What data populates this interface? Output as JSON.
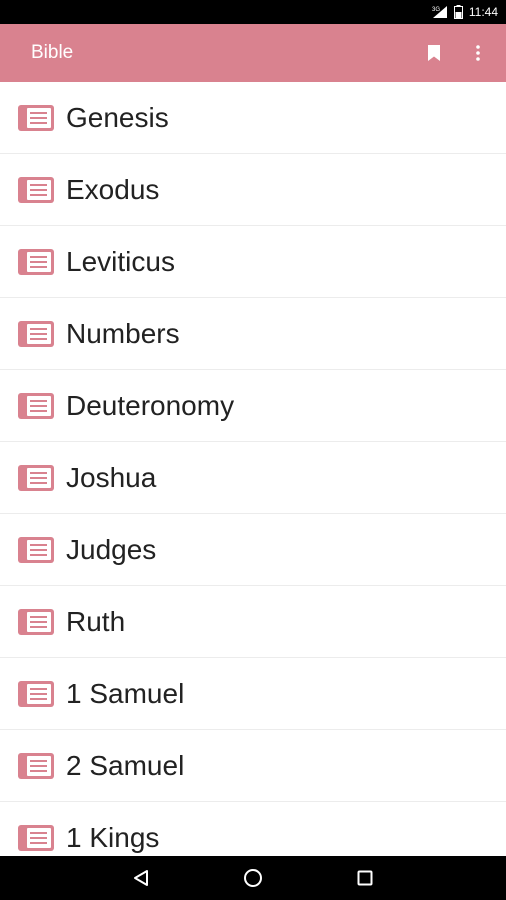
{
  "status_bar": {
    "time": "11:44",
    "icons": [
      "signal-icon",
      "battery-icon"
    ]
  },
  "app_bar": {
    "title": "Bible",
    "actions": [
      "bookmark-icon",
      "more-vert-icon"
    ]
  },
  "books": [
    {
      "label": "Genesis"
    },
    {
      "label": "Exodus"
    },
    {
      "label": "Leviticus"
    },
    {
      "label": "Numbers"
    },
    {
      "label": "Deuteronomy"
    },
    {
      "label": "Joshua"
    },
    {
      "label": "Judges"
    },
    {
      "label": "Ruth"
    },
    {
      "label": "1 Samuel"
    },
    {
      "label": "2 Samuel"
    },
    {
      "label": "1 Kings"
    }
  ],
  "nav_bar": {
    "buttons": [
      "back-icon",
      "home-icon",
      "recents-icon"
    ]
  },
  "colors": {
    "accent": "#d9828f",
    "status_bar": "#000000",
    "text": "#222222"
  }
}
